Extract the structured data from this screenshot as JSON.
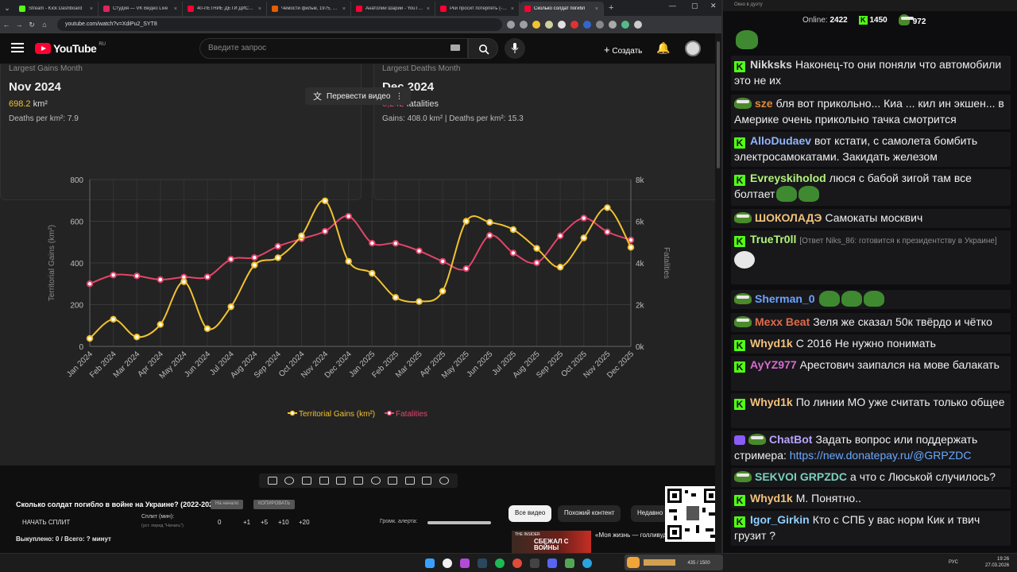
{
  "browser": {
    "tabs": [
      {
        "title": "Stream - Kick Dashboard",
        "color": "#53fc18",
        "active": false
      },
      {
        "title": "Студия — VK Видео Live",
        "color": "#e0245e",
        "active": false
      },
      {
        "title": "40-ЛЕТНИЕ ДЕТИ ДИСНЕЯ",
        "color": "#ff0033",
        "active": false
      },
      {
        "title": "Чемости фильм, 1975, дата",
        "color": "#e65c00",
        "active": false
      },
      {
        "title": "Анатолий Шарий - YouTube",
        "color": "#ff0033",
        "active": false
      },
      {
        "title": "Рки просит потерпеть (-) - Y",
        "color": "#ff0033",
        "active": false
      },
      {
        "title": "Сколько солдат погибл",
        "color": "#ff0033",
        "active": true
      }
    ],
    "url": "youtube.com/watch?v=XdiPu2_SYT8",
    "close_glyph": "×",
    "newtab_glyph": "+"
  },
  "youtube": {
    "logo": "YouTube",
    "region": "RU",
    "search_placeholder": "Введите запрос",
    "create_label": "Создать"
  },
  "video": {
    "card_left": {
      "label": "Largest Gains Month",
      "month": "Nov 2024",
      "value": "698.2",
      "unit": "km²",
      "sub": "Deaths per km²: 7.9"
    },
    "card_right": {
      "label": "Largest Deaths Month",
      "month": "Dec 2024",
      "value": "6,242",
      "unit": "fatalities",
      "sub": "Gains: 408.0 km² | Deaths per km²: 15.3"
    },
    "translate_label": "Перевести видео",
    "translate_menu": "⋮"
  },
  "chart_data": {
    "type": "line",
    "categories": [
      "Jan 2024",
      "Feb 2024",
      "Mar 2024",
      "Apr 2024",
      "May 2024",
      "Jun 2024",
      "Jul 2024",
      "Aug 2024",
      "Sep 2024",
      "Oct 2024",
      "Nov 2024",
      "Dec 2024",
      "Jan 2025",
      "Feb 2025",
      "Mar 2025",
      "Apr 2025",
      "May 2025",
      "Jun 2025",
      "Jul 2025",
      "Aug 2025",
      "Sep 2025",
      "Oct 2025",
      "Nov 2025",
      "Dec 2025"
    ],
    "ylabel": "Territorial Gains (km²)",
    "y2label": "Fatalities",
    "ylim": [
      0,
      800
    ],
    "y2lim": [
      0,
      8000
    ],
    "yticks": [
      "0",
      "200",
      "400",
      "600",
      "800"
    ],
    "y2ticks": [
      "0k",
      "2k",
      "4k",
      "6k",
      "8k"
    ],
    "legend_position": "bottom",
    "grid": true,
    "series": [
      {
        "name": "Territorial Gains (km²)",
        "color": "#f2c230",
        "axis": "left",
        "values": [
          38,
          130,
          45,
          105,
          310,
          85,
          190,
          390,
          425,
          530,
          698,
          408,
          350,
          235,
          215,
          265,
          600,
          595,
          560,
          470,
          380,
          520,
          665,
          475
        ]
      },
      {
        "name": "Fatalities",
        "color": "#e2456a",
        "axis": "right",
        "values": [
          3000,
          3420,
          3380,
          3200,
          3320,
          3330,
          4180,
          4260,
          4800,
          5160,
          5520,
          6242,
          4950,
          4940,
          4580,
          4080,
          3730,
          5320,
          4480,
          4010,
          5300,
          6150,
          5490,
          5100
        ]
      }
    ]
  },
  "lower": {
    "video_title": "Сколько солдат погибло в войне на Украине? (2022-2026)",
    "btn_start": "На начало",
    "btn_copy": "КОПИРОВАТЬ",
    "split_button": "НАЧАТЬ СПЛИТ",
    "split_label": "Сплит (мин):",
    "split_hint": "(уст. перед \"Начать\")",
    "split_values": [
      "0",
      "+1",
      "+5",
      "+10",
      "+20"
    ],
    "volume_label": "Громк. алерта:",
    "spent": "Выкуплено: 0 / Всего: ? минут",
    "chips": [
      "Все видео",
      "Похожий контент",
      "Недавно"
    ],
    "reco_title": "«Моя жизнь — голливудский блокбастер». История казак...",
    "reco_thumb_top": "THE INSIDER",
    "reco_thumb_text": "СБЕЖАЛ С ВОЙНЫ"
  },
  "chat": {
    "window_title": "Окно в дуэту",
    "online_label": "Online:",
    "online_value": "2422",
    "kick_count": "1450",
    "other_count": "972",
    "messages": [
      {
        "badge": "kick",
        "user": "Nikksks",
        "color": "#d8d8d8",
        "text": "Наконец-то они поняли что автомобили это не их"
      },
      {
        "badge": "pepe",
        "user": "sze",
        "color": "#e08a3a",
        "text": "бля вот прикольно... Киа ... кил ин экшен... в Америке очень прикольно тачка смотрится"
      },
      {
        "badge": "kick",
        "user": "AlloDudaev",
        "color": "#8fb4ff",
        "text": "вот кстати, с самолета бомбить электросамокатами. Закидать железом"
      },
      {
        "badge": "kick",
        "user": "Evreyskiholod",
        "color": "#b3f27a",
        "text": "люся с бабой зигой там все болтает"
      },
      {
        "badge": "pepe",
        "user": "ШОКОЛАДЭ",
        "color": "#f2c27a",
        "text": "Самокаты москвич"
      },
      {
        "badge": "kick",
        "user": "TrueTr0ll",
        "color": "#b3f27a",
        "reply": "[Ответ Niks_86: готовится к президентству в Украине]",
        "text": ""
      },
      {
        "badge": "pepe",
        "user": "Sherman_0",
        "color": "#6ba3ff",
        "text": ""
      },
      {
        "badge": "pepe",
        "user": "Mexx Beat",
        "color": "#e06a4a",
        "text": "Зеля же сказал 50к твёрдо и чётко"
      },
      {
        "badge": "kick",
        "user": "Whyd1k",
        "color": "#f2c27a",
        "text": "С 2016 Не нужно понимать"
      },
      {
        "badge": "kick",
        "user": "AyYZ977",
        "color": "#d96ad0",
        "text": "Арестович заипался на мове балакать"
      },
      {
        "badge": "kick",
        "user": "Whyd1k",
        "color": "#f2c27a",
        "text": "По линии МО уже считать только общее"
      },
      {
        "badge": "bot",
        "user": "ChatBot",
        "color": "#b9a4ff",
        "text": "Задать вопрос или поддержать стримера:",
        "link": "https://new.donatepay.ru/@GRPZDC"
      },
      {
        "badge": "pepe",
        "user": "SEKVOI",
        "color": "#7ad0c0",
        "mention": "GRPZDC",
        "text": "а что с Люськой случилось?"
      },
      {
        "badge": "kick",
        "user": "Whyd1k",
        "color": "#f2c27a",
        "text": "М. Понятно.."
      },
      {
        "badge": "kick",
        "user": "Igor_Girkin",
        "color": "#8fd0ff",
        "text": "Кто с СПБ у вас норм Кик и твич грузит ?"
      }
    ]
  },
  "taskbar": {
    "lang": "РУС",
    "time": "19:26",
    "date": "27.03.2026",
    "streamer_count": "435 / 1500"
  }
}
